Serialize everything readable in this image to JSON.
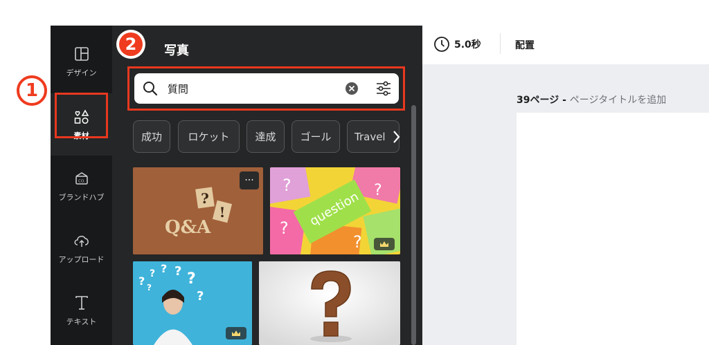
{
  "sidebar": {
    "items": [
      {
        "label": "デザイン",
        "icon": "layout-icon"
      },
      {
        "label": "素材",
        "icon": "elements-icon"
      },
      {
        "label": "ブランドハブ",
        "icon": "brand-hub-icon"
      },
      {
        "label": "アップロード",
        "icon": "upload-cloud-icon"
      },
      {
        "label": "テキスト",
        "icon": "text-t-icon"
      }
    ]
  },
  "panel": {
    "title": "写真",
    "search": {
      "value": "質問"
    },
    "chips": [
      "成功",
      "ロケット",
      "達成",
      "ゴール",
      "Travel"
    ]
  },
  "thumbs": {
    "qa_text": "Q&A",
    "sticky_text": "question",
    "more": "···"
  },
  "editor": {
    "duration": "5.0秒",
    "arrange": "配置",
    "page_number": "39ページ",
    "page_sep": " - ",
    "page_title_placeholder": "ページタイトルを追加"
  },
  "annotations": {
    "step1": "1",
    "step2": "2"
  },
  "colors": {
    "accent_red": "#e8381f",
    "panel_bg": "#252627",
    "rail_bg": "#18191b"
  }
}
